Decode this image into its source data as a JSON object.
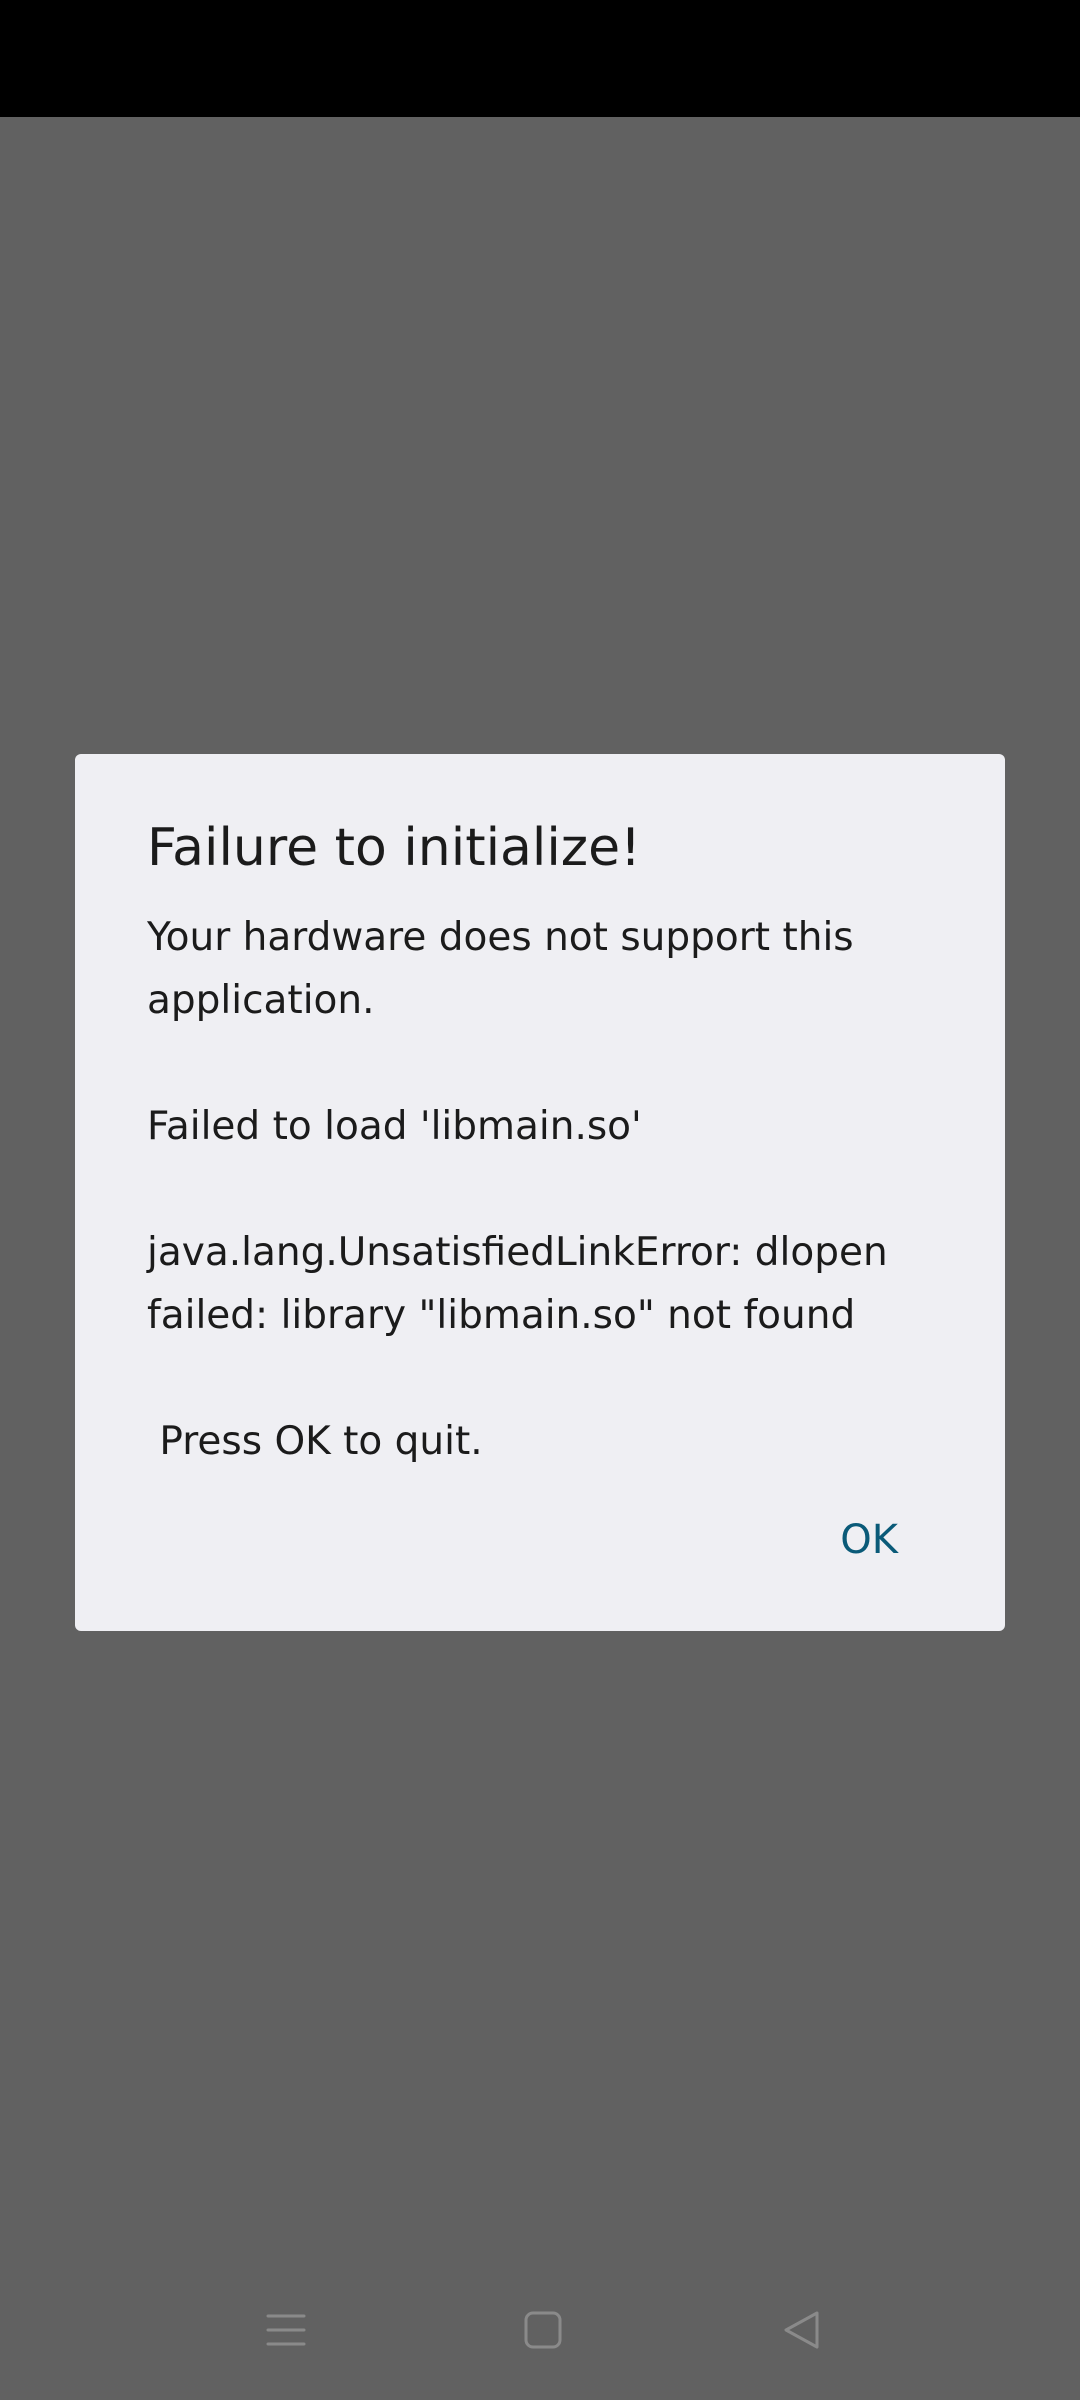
{
  "dialog": {
    "title": "Failure to initialize!",
    "message": "Your hardware does not support this application.\n\nFailed to load 'libmain.so'\n\njava.lang.UnsatisfiedLinkError: dlopen failed: library \"libmain.so\" not found\n\n Press OK to quit.",
    "ok_label": "OK"
  },
  "nav": {
    "menu_icon": "menu-icon",
    "home_icon": "home-icon",
    "back_icon": "back-icon"
  },
  "colors": {
    "status_bar": "#000000",
    "scrim": "#616161",
    "dialog_bg": "#efeff3",
    "text": "#1b1b1b",
    "accent": "#0a5a78",
    "nav_icon": "#8a8a8a"
  }
}
